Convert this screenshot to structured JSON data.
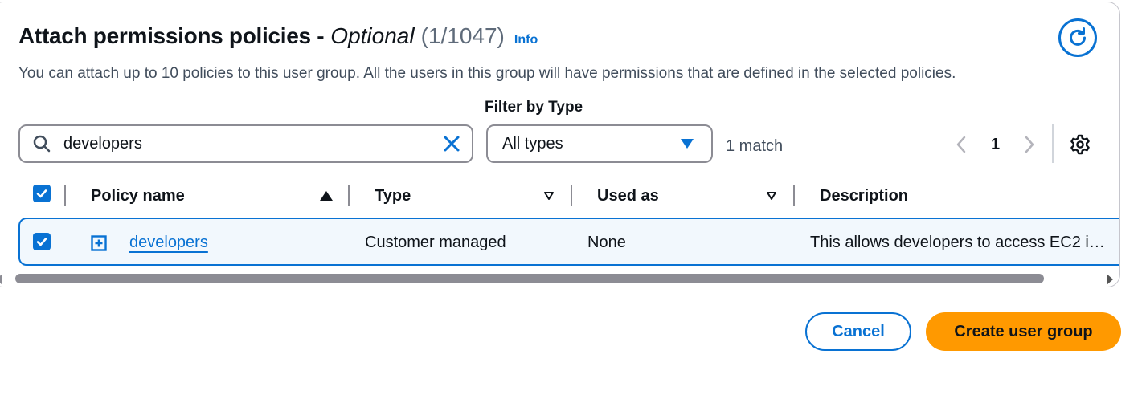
{
  "section": {
    "title": "Attach permissions policies -",
    "title_optional": "Optional",
    "count": "(1/1047)",
    "info_link": "Info",
    "description": "You can attach up to 10 policies to this user group. All the users in this group will have permissions that are defined in the selected policies."
  },
  "filters": {
    "search_value": "developers",
    "type_label": "Filter by Type",
    "type_selected": "All types",
    "match_count": "1 match"
  },
  "pagination": {
    "current_page": "1"
  },
  "table": {
    "columns": [
      "Policy name",
      "Type",
      "Used as",
      "Description"
    ],
    "rows": [
      {
        "selected": true,
        "policy_name": "developers",
        "type": "Customer managed",
        "used_as": "None",
        "description": "This allows developers to access EC2 i…"
      }
    ]
  },
  "actions": {
    "cancel": "Cancel",
    "create": "Create user group"
  },
  "colors": {
    "accent": "#0972d3",
    "primary_button": "#ff9900",
    "row_selected_bg": "#f2f8fd"
  }
}
